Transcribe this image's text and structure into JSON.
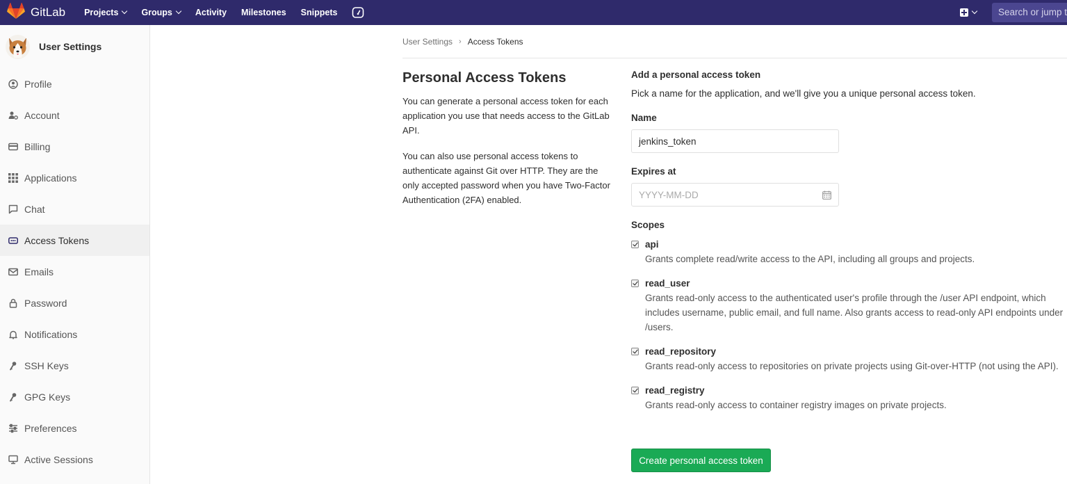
{
  "navbar": {
    "brand": "GitLab",
    "links": [
      {
        "label": "Projects",
        "dropdown": true
      },
      {
        "label": "Groups",
        "dropdown": true
      },
      {
        "label": "Activity",
        "dropdown": false
      },
      {
        "label": "Milestones",
        "dropdown": false
      },
      {
        "label": "Snippets",
        "dropdown": false
      }
    ],
    "search_placeholder": "Search or jump to",
    "colors": {
      "background": "#2f2a6b",
      "search": "#4b4690"
    }
  },
  "sidebar": {
    "title": "User Settings",
    "items": [
      {
        "label": "Profile",
        "icon": "profile-icon",
        "active": false
      },
      {
        "label": "Account",
        "icon": "account-icon",
        "active": false
      },
      {
        "label": "Billing",
        "icon": "credit-card-icon",
        "active": false
      },
      {
        "label": "Applications",
        "icon": "applications-icon",
        "active": false
      },
      {
        "label": "Chat",
        "icon": "chat-icon",
        "active": false
      },
      {
        "label": "Access Tokens",
        "icon": "token-icon",
        "active": true
      },
      {
        "label": "Emails",
        "icon": "envelope-icon",
        "active": false
      },
      {
        "label": "Password",
        "icon": "lock-icon",
        "active": false
      },
      {
        "label": "Notifications",
        "icon": "bell-icon",
        "active": false
      },
      {
        "label": "SSH Keys",
        "icon": "key-icon",
        "active": false
      },
      {
        "label": "GPG Keys",
        "icon": "key-icon",
        "active": false
      },
      {
        "label": "Preferences",
        "icon": "sliders-icon",
        "active": false
      },
      {
        "label": "Active Sessions",
        "icon": "monitor-icon",
        "active": false
      }
    ]
  },
  "breadcrumb": {
    "parent": "User Settings",
    "current": "Access Tokens"
  },
  "intro": {
    "title": "Personal Access Tokens",
    "paragraph1": "You can generate a personal access token for each application you use that needs access to the GitLab API.",
    "paragraph2": "You can also use personal access tokens to authenticate against Git over HTTP. They are the only accepted password when you have Two-Factor Authentication (2FA) enabled."
  },
  "form": {
    "heading": "Add a personal access token",
    "subheading": "Pick a name for the application, and we'll give you a unique personal access token.",
    "name_label": "Name",
    "name_value": "jenkins_token",
    "expires_label": "Expires at",
    "expires_placeholder": "YYYY-MM-DD",
    "scopes_label": "Scopes",
    "scopes": [
      {
        "name": "api",
        "checked": true,
        "description": "Grants complete read/write access to the API, including all groups and projects."
      },
      {
        "name": "read_user",
        "checked": true,
        "description": "Grants read-only access to the authenticated user's profile through the /user API endpoint, which includes username, public email, and full name. Also grants access to read-only API endpoints under /users."
      },
      {
        "name": "read_repository",
        "checked": true,
        "description": "Grants read-only access to repositories on private projects using Git-over-HTTP (not using the API)."
      },
      {
        "name": "read_registry",
        "checked": true,
        "description": "Grants read-only access to container registry images on private projects."
      }
    ],
    "submit_label": "Create personal access token",
    "submit_color": "#1aaa55"
  }
}
